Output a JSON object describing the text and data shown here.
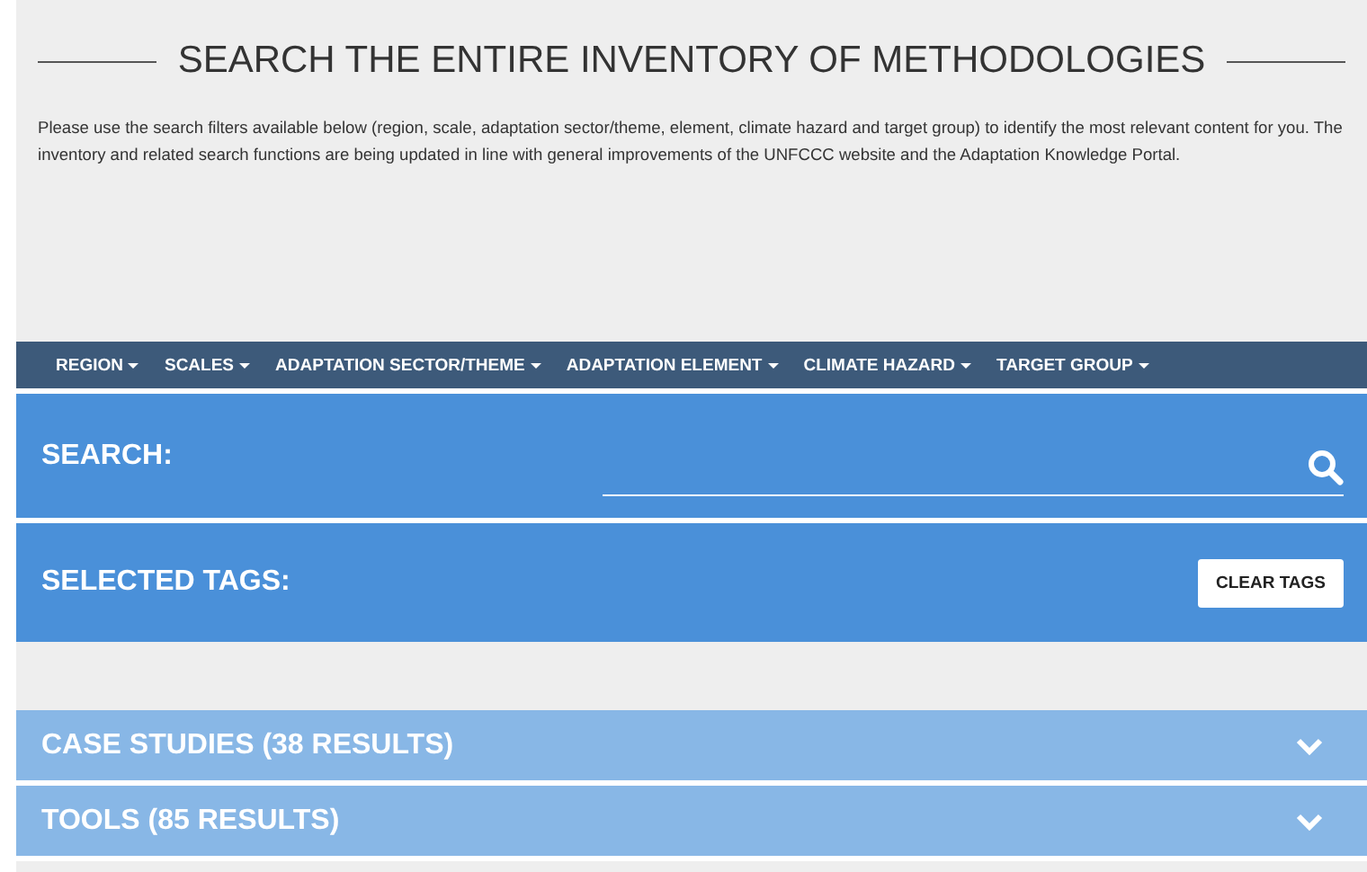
{
  "header": {
    "title": "SEARCH THE ENTIRE INVENTORY OF METHODOLOGIES",
    "intro": "Please use the search filters available below (region, scale, adaptation sector/theme, element, climate hazard and target group) to identify the most relevant content for you. The inventory and related search functions are being updated in line with general improvements of the UNFCCC website and the Adaptation Knowledge Portal."
  },
  "filters": [
    {
      "label": "REGION"
    },
    {
      "label": "SCALES"
    },
    {
      "label": "ADAPTATION SECTOR/THEME"
    },
    {
      "label": "ADAPTATION ELEMENT"
    },
    {
      "label": "CLIMATE HAZARD"
    },
    {
      "label": "TARGET GROUP"
    }
  ],
  "search": {
    "label": "SEARCH:"
  },
  "selected_tags": {
    "label": "SELECTED TAGS:",
    "button": "CLEAR TAGS"
  },
  "results": [
    {
      "label": "CASE STUDIES (38 RESULTS)",
      "expanded": false
    },
    {
      "label": "TOOLS (85 RESULTS)",
      "expanded": false
    }
  ]
}
